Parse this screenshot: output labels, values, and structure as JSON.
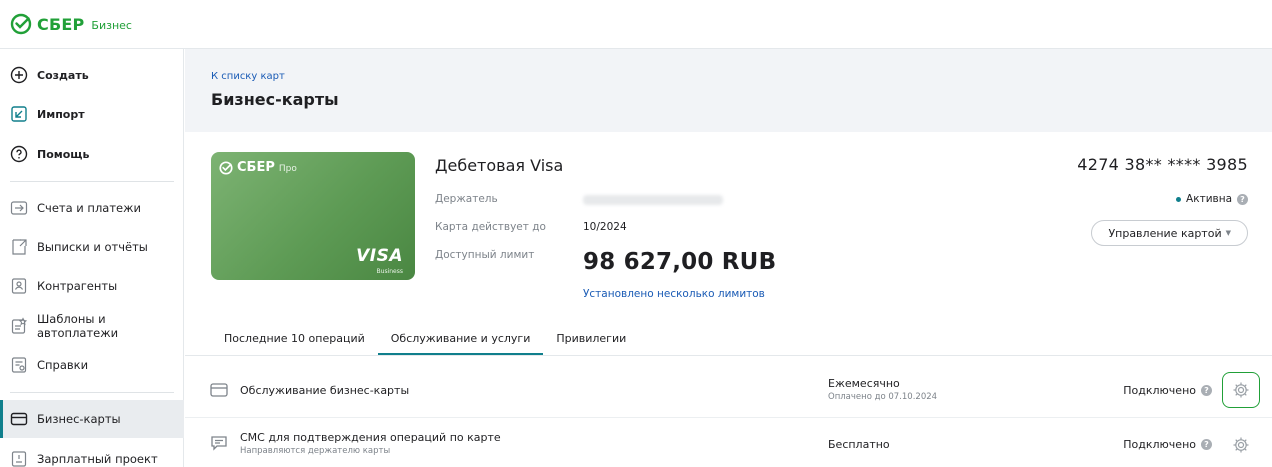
{
  "brand": {
    "name": "СБЕР",
    "sub": "Бизнес",
    "color": "#21a038"
  },
  "sidebar": {
    "primary": [
      {
        "label": "Создать",
        "icon": "plus-circle-icon"
      },
      {
        "label": "Импорт",
        "icon": "import-icon"
      },
      {
        "label": "Помощь",
        "icon": "help-icon"
      }
    ],
    "items": [
      {
        "label": "Счета и платежи",
        "icon": "transfer-icon"
      },
      {
        "label": "Выписки и отчёты",
        "icon": "statement-icon"
      },
      {
        "label": "Контрагенты",
        "icon": "contacts-icon"
      },
      {
        "label": "Шаблоны и автоплатежи",
        "icon": "templates-icon"
      },
      {
        "label": "Справки",
        "icon": "certificate-icon"
      }
    ],
    "secondary": [
      {
        "label": "Бизнес-карты",
        "icon": "card-icon",
        "active": true
      },
      {
        "label": "Зарплатный проект",
        "icon": "salary-icon"
      }
    ]
  },
  "header": {
    "back_link": "К списку карт",
    "title": "Бизнес-карты"
  },
  "card": {
    "visual": {
      "brand": "СБЕР",
      "brand_sub": "Про",
      "network": "VISA",
      "network_sub": "Business"
    },
    "name": "Дебетовая Visa",
    "holder_label": "Держатель",
    "valid_label": "Карта действует до",
    "valid_value": "10/2024",
    "limit_label": "Доступный лимит",
    "limit_amount": "98 627,00 RUB",
    "limit_link": "Установлено несколько лимитов",
    "number": "4274 38** **** 3985",
    "status": "Активна",
    "manage_button": "Управление картой"
  },
  "tabs": [
    {
      "label": "Последние 10 операций",
      "active": false
    },
    {
      "label": "Обслуживание и услуги",
      "active": true
    },
    {
      "label": "Привилегии",
      "active": false
    }
  ],
  "services": [
    {
      "title": "Обслуживание бизнес-карты",
      "subtitle": "",
      "period": "Ежемесячно",
      "paid": "Оплачено до 07.10.2024",
      "state": "Подключено",
      "icon": "card-outline-icon"
    },
    {
      "title": "СМС для подтверждения операций по карте",
      "subtitle": "Направляются держателю карты",
      "period": "Бесплатно",
      "paid": "",
      "state": "Подключено",
      "icon": "message-icon"
    }
  ],
  "colors": {
    "accent": "#107f8c",
    "link": "#1a5bb5",
    "card_green": "#5e9b55"
  }
}
